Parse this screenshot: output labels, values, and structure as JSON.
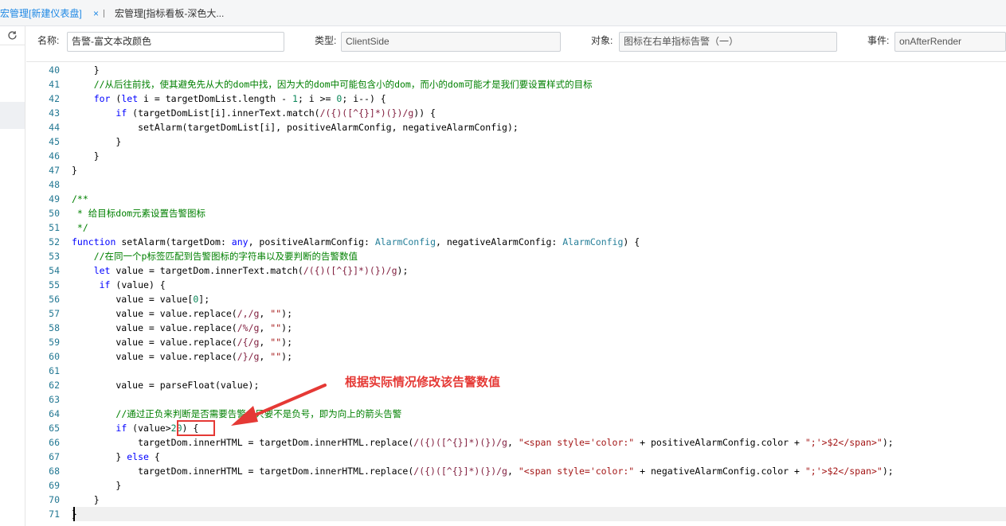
{
  "tabs": [
    {
      "label": "宏管理[新建仪表盘]",
      "active": true
    },
    {
      "label": "宏管理[指标看板-深色大...",
      "active": false
    }
  ],
  "tab_close_glyph": "×",
  "form": {
    "name_label": "名称:",
    "name_value": "告警-富文本改颜色",
    "type_label": "类型:",
    "type_value": "ClientSide",
    "object_label": "对象:",
    "object_value": "图标在右单指标告警（一）",
    "event_label": "事件:",
    "event_value": "onAfterRender"
  },
  "icons": {
    "refresh": "refresh-icon",
    "arrow": "annotation-arrow-icon"
  },
  "colors": {
    "accent": "#1e88e5",
    "annotation": "#e53935",
    "keyword": "#0000ff",
    "comment": "#008000",
    "string": "#a31515"
  },
  "annotation": {
    "text": "根据实际情况修改该告警数值"
  },
  "code": {
    "lines": [
      {
        "no": "40",
        "tokens": [
          [
            "",
            "    }"
          ]
        ]
      },
      {
        "no": "41",
        "tokens": [
          [
            "",
            "    "
          ],
          [
            "cm",
            "//从后往前找，使其避免先从大的dom中找，因为大的dom中可能包含小的dom，而小的dom可能才是我们要设置样式的目标"
          ]
        ]
      },
      {
        "no": "42",
        "tokens": [
          [
            "",
            "    "
          ],
          [
            "kw",
            "for"
          ],
          [
            "",
            " ("
          ],
          [
            "kw",
            "let"
          ],
          [
            "",
            " i = targetDomList.length - "
          ],
          [
            "num",
            "1"
          ],
          [
            "",
            "; i >= "
          ],
          [
            "num",
            "0"
          ],
          [
            "",
            "; i--) {"
          ]
        ]
      },
      {
        "no": "43",
        "tokens": [
          [
            "",
            "        "
          ],
          [
            "kw",
            "if"
          ],
          [
            "",
            " (targetDomList[i].innerText.match("
          ],
          [
            "re",
            "/({)([^{}]*)(})/g"
          ],
          [
            "",
            ")) {"
          ]
        ]
      },
      {
        "no": "44",
        "tokens": [
          [
            "",
            "            setAlarm(targetDomList[i], positiveAlarmConfig, negativeAlarmConfig);"
          ]
        ]
      },
      {
        "no": "45",
        "tokens": [
          [
            "",
            "        }"
          ]
        ]
      },
      {
        "no": "46",
        "tokens": [
          [
            "",
            "    }"
          ]
        ]
      },
      {
        "no": "47",
        "tokens": [
          [
            "",
            "}"
          ]
        ]
      },
      {
        "no": "48",
        "tokens": [
          [
            "",
            ""
          ]
        ]
      },
      {
        "no": "49",
        "tokens": [
          [
            "cm",
            "/**"
          ]
        ]
      },
      {
        "no": "50",
        "tokens": [
          [
            "cm",
            " * 给目标dom元素设置告警图标"
          ]
        ]
      },
      {
        "no": "51",
        "tokens": [
          [
            "cm",
            " */"
          ]
        ]
      },
      {
        "no": "52",
        "tokens": [
          [
            "kw",
            "function"
          ],
          [
            "",
            " setAlarm(targetDom: "
          ],
          [
            "kw",
            "any"
          ],
          [
            "",
            ", positiveAlarmConfig: "
          ],
          [
            "ty",
            "AlarmConfig"
          ],
          [
            "",
            ", negativeAlarmConfig: "
          ],
          [
            "ty",
            "AlarmConfig"
          ],
          [
            "",
            ") {"
          ]
        ]
      },
      {
        "no": "53",
        "tokens": [
          [
            "",
            "    "
          ],
          [
            "cm",
            "//在同一个p标签匹配到告警图标的字符串以及要判断的告警数值"
          ]
        ]
      },
      {
        "no": "54",
        "tokens": [
          [
            "",
            "    "
          ],
          [
            "kw",
            "let"
          ],
          [
            "",
            " value = targetDom.innerText.match("
          ],
          [
            "re",
            "/({)([^{}]*)(})/g"
          ],
          [
            "",
            ");"
          ]
        ]
      },
      {
        "no": "55",
        "tokens": [
          [
            "",
            "     "
          ],
          [
            "kw",
            "if"
          ],
          [
            "",
            " (value) {"
          ]
        ]
      },
      {
        "no": "56",
        "tokens": [
          [
            "",
            "        value = value["
          ],
          [
            "num",
            "0"
          ],
          [
            "",
            "];"
          ]
        ]
      },
      {
        "no": "57",
        "tokens": [
          [
            "",
            "        value = value.replace("
          ],
          [
            "re",
            "/,/g"
          ],
          [
            "",
            ", "
          ],
          [
            "str",
            "\"\""
          ],
          [
            "",
            ");"
          ]
        ]
      },
      {
        "no": "58",
        "tokens": [
          [
            "",
            "        value = value.replace("
          ],
          [
            "re",
            "/%/g"
          ],
          [
            "",
            ", "
          ],
          [
            "str",
            "\"\""
          ],
          [
            "",
            ");"
          ]
        ]
      },
      {
        "no": "59",
        "tokens": [
          [
            "",
            "        value = value.replace("
          ],
          [
            "re",
            "/{/g"
          ],
          [
            "",
            ", "
          ],
          [
            "str",
            "\"\""
          ],
          [
            "",
            ");"
          ]
        ]
      },
      {
        "no": "60",
        "tokens": [
          [
            "",
            "        value = value.replace("
          ],
          [
            "re",
            "/}/g"
          ],
          [
            "",
            ", "
          ],
          [
            "str",
            "\"\""
          ],
          [
            "",
            ");"
          ]
        ]
      },
      {
        "no": "61",
        "tokens": [
          [
            "",
            ""
          ]
        ]
      },
      {
        "no": "62",
        "tokens": [
          [
            "",
            "        value = parseFloat(value);"
          ]
        ]
      },
      {
        "no": "63",
        "tokens": [
          [
            "",
            ""
          ]
        ]
      },
      {
        "no": "64",
        "tokens": [
          [
            "",
            "        "
          ],
          [
            "cm",
            "//通过正负来判断是否需要告警，只要不是负号，即为向上的箭头告警"
          ]
        ]
      },
      {
        "no": "65",
        "tokens": [
          [
            "",
            "        "
          ],
          [
            "kw",
            "if"
          ],
          [
            "",
            " (value>"
          ],
          [
            "num",
            "20"
          ],
          [
            "",
            ") {"
          ]
        ]
      },
      {
        "no": "66",
        "tokens": [
          [
            "",
            "            targetDom.innerHTML = targetDom.innerHTML.replace("
          ],
          [
            "re",
            "/({)([^{}]*)(})/g"
          ],
          [
            "",
            ", "
          ],
          [
            "str",
            "\"<span style='color:\""
          ],
          [
            "",
            " + positiveAlarmConfig.color + "
          ],
          [
            "str",
            "\";'>$2</span>\""
          ],
          [
            "",
            ");"
          ]
        ]
      },
      {
        "no": "67",
        "tokens": [
          [
            "",
            "        } "
          ],
          [
            "kw",
            "else"
          ],
          [
            "",
            " {"
          ]
        ]
      },
      {
        "no": "68",
        "tokens": [
          [
            "",
            "            targetDom.innerHTML = targetDom.innerHTML.replace("
          ],
          [
            "re",
            "/({)([^{}]*)(})/g"
          ],
          [
            "",
            ", "
          ],
          [
            "str",
            "\"<span style='color:\""
          ],
          [
            "",
            " + negativeAlarmConfig.color + "
          ],
          [
            "str",
            "\";'>$2</span>\""
          ],
          [
            "",
            ");"
          ]
        ]
      },
      {
        "no": "69",
        "tokens": [
          [
            "",
            "        }"
          ]
        ]
      },
      {
        "no": "70",
        "tokens": [
          [
            "",
            "    }"
          ]
        ]
      },
      {
        "no": "71",
        "tokens": [
          [
            "",
            "}"
          ]
        ]
      }
    ]
  }
}
